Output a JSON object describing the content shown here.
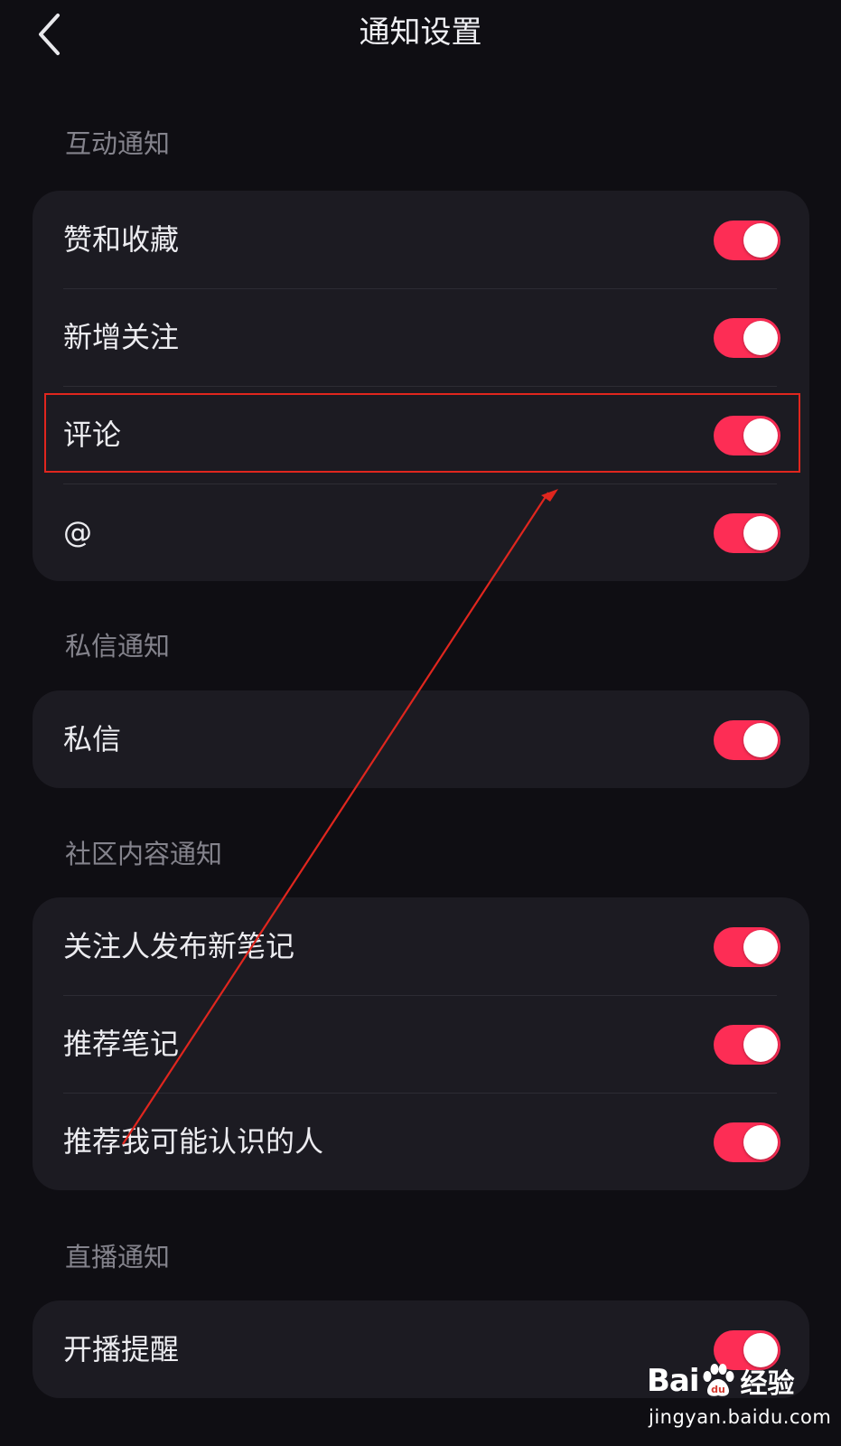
{
  "header": {
    "title": "通知设置",
    "back_icon": "chevron-left-icon"
  },
  "sections": [
    {
      "title": "互动通知",
      "items": [
        {
          "label": "赞和收藏",
          "enabled": true
        },
        {
          "label": "新增关注",
          "enabled": true
        },
        {
          "label": "评论",
          "enabled": true
        },
        {
          "label": "@",
          "enabled": true
        }
      ]
    },
    {
      "title": "私信通知",
      "items": [
        {
          "label": "私信",
          "enabled": true
        }
      ]
    },
    {
      "title": "社区内容通知",
      "items": [
        {
          "label": "关注人发布新笔记",
          "enabled": true
        },
        {
          "label": "推荐笔记",
          "enabled": true
        },
        {
          "label": "推荐我可能认识的人",
          "enabled": true
        }
      ]
    },
    {
      "title": "直播通知",
      "items": [
        {
          "label": "开播提醒",
          "enabled": true
        }
      ]
    }
  ],
  "colors": {
    "background": "#0f0e13",
    "card": "#1c1b22",
    "toggle_on": "#fd2d55",
    "annotation": "#e0261e"
  },
  "watermark": {
    "logo_part1": "Bai",
    "logo_part2": "du",
    "brand": "经验",
    "url": "jingyan.baidu.com"
  }
}
